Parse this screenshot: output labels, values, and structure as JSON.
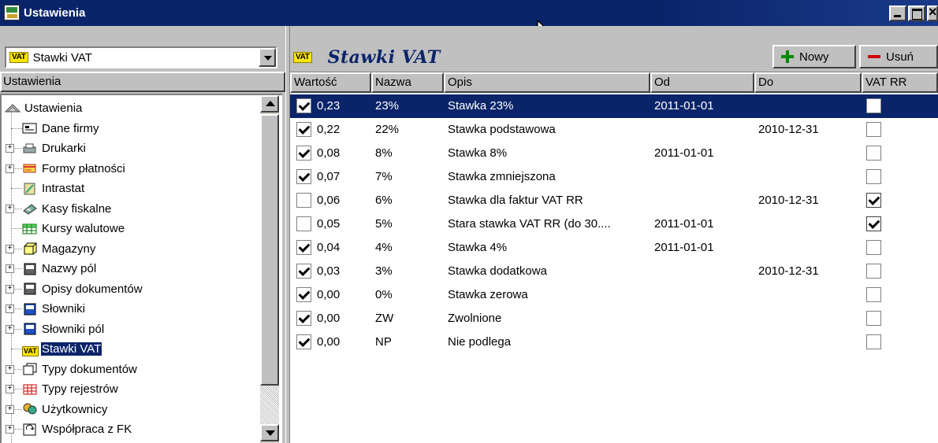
{
  "window": {
    "title": "Ustawienia"
  },
  "left": {
    "combo_badge": "VAT",
    "combo_value": "Stawki VAT",
    "tree_header": "Ustawienia",
    "tree": [
      {
        "label": "Ustawienia",
        "icon": "settings-root-icon",
        "level": 0,
        "expander": false
      },
      {
        "label": "Dane firmy",
        "icon": "company-card-icon",
        "level": 1,
        "expander": false
      },
      {
        "label": "Drukarki",
        "icon": "printer-icon",
        "level": 1,
        "expander": true
      },
      {
        "label": "Formy płatności",
        "icon": "payment-icon",
        "level": 1,
        "expander": true
      },
      {
        "label": "Intrastat",
        "icon": "intrastat-icon",
        "level": 1,
        "expander": false
      },
      {
        "label": "Kasy fiskalne",
        "icon": "cash-register-icon",
        "level": 1,
        "expander": true
      },
      {
        "label": "Kursy walutowe",
        "icon": "currency-grid-icon",
        "level": 1,
        "expander": false
      },
      {
        "label": "Magazyny",
        "icon": "warehouse-icon",
        "level": 1,
        "expander": true
      },
      {
        "label": "Nazwy pól",
        "icon": "field-names-icon",
        "level": 1,
        "expander": true
      },
      {
        "label": "Opisy dokumentów",
        "icon": "document-descriptions-icon",
        "level": 1,
        "expander": true
      },
      {
        "label": "Słowniki",
        "icon": "dictionary-icon",
        "level": 1,
        "expander": true
      },
      {
        "label": "Słowniki pól",
        "icon": "field-dictionary-icon",
        "level": 1,
        "expander": true
      },
      {
        "label": "Stawki VAT",
        "icon": "vat-icon",
        "level": 1,
        "expander": false,
        "selected": true
      },
      {
        "label": "Typy dokumentów",
        "icon": "document-types-icon",
        "level": 1,
        "expander": true
      },
      {
        "label": "Typy rejestrów",
        "icon": "register-types-icon",
        "level": 1,
        "expander": true
      },
      {
        "label": "Użytkownicy",
        "icon": "users-icon",
        "level": 1,
        "expander": true
      },
      {
        "label": "Współpraca z FK",
        "icon": "fk-cooperation-icon",
        "level": 1,
        "expander": true
      }
    ]
  },
  "right": {
    "badge": "VAT",
    "title": "Stawki VAT",
    "new_label": "Nowy",
    "delete_label": "Usuń",
    "columns": [
      "Wartość",
      "Nazwa",
      "Opis",
      "Od",
      "Do",
      "VAT RR"
    ],
    "rows": [
      {
        "checked": true,
        "value": "0,23",
        "name": "23%",
        "desc": "Stawka 23%",
        "from": "2011-01-01",
        "to": "",
        "vatrr": false,
        "selected": true
      },
      {
        "checked": true,
        "value": "0,22",
        "name": "22%",
        "desc": "Stawka podstawowa",
        "from": "",
        "to": "2010-12-31",
        "vatrr": false
      },
      {
        "checked": true,
        "value": "0,08",
        "name": "8%",
        "desc": "Stawka 8%",
        "from": "2011-01-01",
        "to": "",
        "vatrr": false
      },
      {
        "checked": true,
        "value": "0,07",
        "name": "7%",
        "desc": "Stawka zmniejszona",
        "from": "",
        "to": "",
        "vatrr": false
      },
      {
        "checked": false,
        "value": "0,06",
        "name": "6%",
        "desc": "Stawka dla faktur VAT RR",
        "from": "",
        "to": "2010-12-31",
        "vatrr": true
      },
      {
        "checked": false,
        "value": "0,05",
        "name": "5%",
        "desc": "Stara stawka VAT RR (do 30....",
        "from": "2011-01-01",
        "to": "",
        "vatrr": true
      },
      {
        "checked": true,
        "value": "0,04",
        "name": "4%",
        "desc": "Stawka 4%",
        "from": "2011-01-01",
        "to": "",
        "vatrr": false
      },
      {
        "checked": true,
        "value": "0,03",
        "name": "3%",
        "desc": "Stawka dodatkowa",
        "from": "",
        "to": "2010-12-31",
        "vatrr": false
      },
      {
        "checked": true,
        "value": "0,00",
        "name": "0%",
        "desc": "Stawka zerowa",
        "from": "",
        "to": "",
        "vatrr": false
      },
      {
        "checked": true,
        "value": "0,00",
        "name": "ZW",
        "desc": "Zwolnione",
        "from": "",
        "to": "",
        "vatrr": false
      },
      {
        "checked": true,
        "value": "0,00",
        "name": "NP",
        "desc": "Nie podlega",
        "from": "",
        "to": "",
        "vatrr": false
      }
    ]
  },
  "colors": {
    "selection": "#0a246a",
    "titlebar": "#0a246a",
    "face": "#c0c0c0",
    "badge": "#ffe600"
  }
}
